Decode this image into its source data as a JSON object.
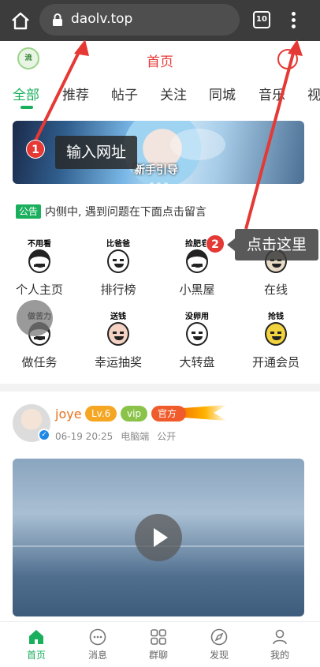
{
  "browser": {
    "url": "daolv.top",
    "tab_count": "10"
  },
  "header": {
    "logo_text": "流",
    "title": "首页"
  },
  "tabs": [
    {
      "label": "全部",
      "active": true
    },
    {
      "label": "推荐"
    },
    {
      "label": "帖子"
    },
    {
      "label": "关注"
    },
    {
      "label": "同城"
    },
    {
      "label": "音乐"
    },
    {
      "label": "视"
    }
  ],
  "banner": {
    "text": "新手引导"
  },
  "callouts": {
    "step1_badge": "1",
    "step1_text": "输入网址",
    "step2_badge": "2",
    "step2_text": "点击这里"
  },
  "notice": {
    "tag": "公告",
    "text": "内侧中, 遇到问题在下面点击留言"
  },
  "grid": [
    {
      "label": "个人主页",
      "caption": "不用看"
    },
    {
      "label": "排行榜",
      "caption": "比爸爸"
    },
    {
      "label": "小黑屋",
      "caption": "捡肥皂"
    },
    {
      "label": "在线",
      "caption": ""
    },
    {
      "label": "做任务",
      "caption": "做苦力"
    },
    {
      "label": "幸运抽奖",
      "caption": "送钱"
    },
    {
      "label": "大转盘",
      "caption": "没卵用"
    },
    {
      "label": "开通会员",
      "caption": "抢钱"
    }
  ],
  "post": {
    "username": "joye",
    "level": "Lv.6",
    "vip": "vip",
    "official": "官方",
    "date": "06-19 20:25",
    "device": "电脑端",
    "visibility": "公开"
  },
  "bottom_nav": [
    {
      "label": "首页",
      "icon": "home-icon",
      "active": true
    },
    {
      "label": "消息",
      "icon": "message-icon"
    },
    {
      "label": "群聊",
      "icon": "group-icon"
    },
    {
      "label": "发现",
      "icon": "compass-icon"
    },
    {
      "label": "我的",
      "icon": "user-icon"
    }
  ],
  "colors": {
    "accent": "#1aaf5d",
    "title_red": "#e53935",
    "browser_bar": "#3c3c3c"
  }
}
